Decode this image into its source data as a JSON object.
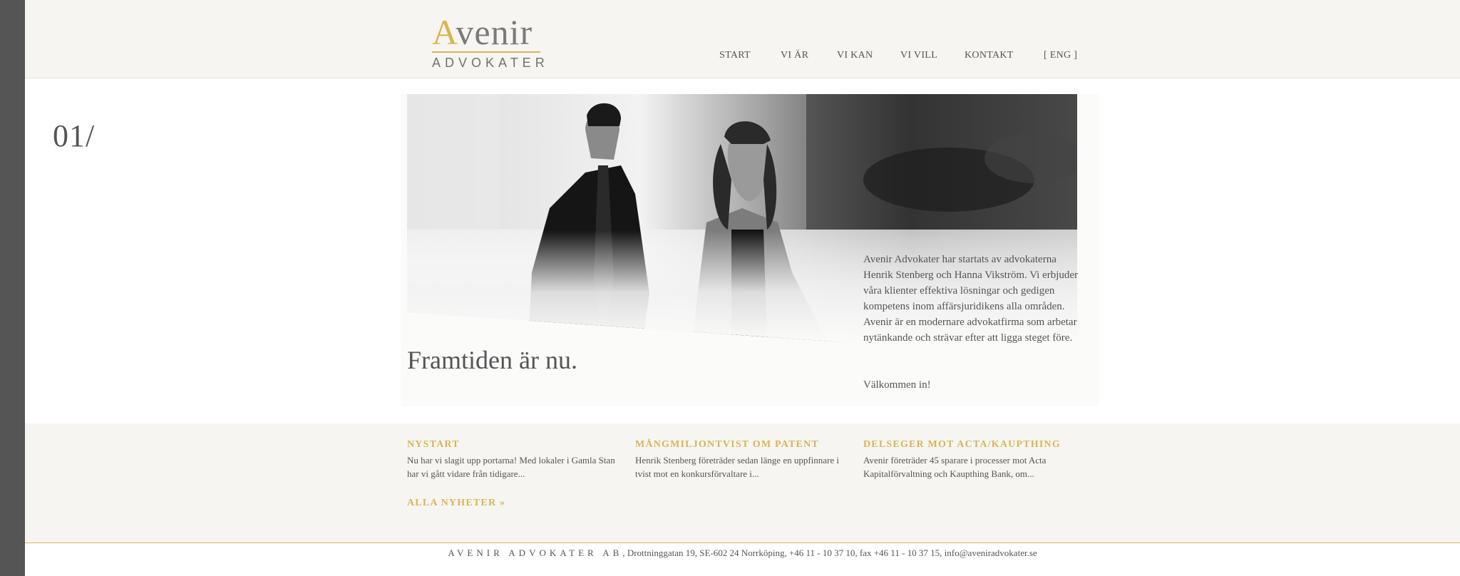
{
  "logo": {
    "initial": "A",
    "rest": "venir",
    "sub": "ADVOKATER"
  },
  "nav": [
    {
      "label": "START"
    },
    {
      "label": "VI ÄR"
    },
    {
      "label": "VI KAN"
    },
    {
      "label": "VI VILL"
    },
    {
      "label": "KONTAKT"
    },
    {
      "label": "[ ENG ]"
    }
  ],
  "page_number": "01/",
  "hero": {
    "title": "Framtiden är nu.",
    "text": "Avenir Advokater har startats av advokaterna Henrik Stenberg och Hanna Vikström. Vi erbjuder våra klienter effektiva lösningar och gedigen kompetens inom affärsjuridikens alla områden. Avenir är en modernare advokatfirma som arbetar nytänkande och strävar efter att ligga steget före.",
    "welcome": "Välkommen in!"
  },
  "news": [
    {
      "title": "NYSTART",
      "text": "Nu har vi slagit upp portarna! Med lokaler i Gamla Stan har vi gått vidare från tidigare..."
    },
    {
      "title": "MÅNGMILJONTVIST OM PATENT",
      "text": "Henrik Stenberg företräder sedan länge en uppfinnare i tvist mot en konkursförvaltare i..."
    },
    {
      "title": "DELSEGER MOT ACTA/KAUPTHING",
      "text": "Avenir företräder 45 sparare i processer mot Acta Kapitalförvaltning och Kaupthing Bank, om..."
    }
  ],
  "all_news": "ALLA NYHETER »",
  "footer": {
    "company": "AVENIR ADVOKATER AB",
    "details": ", Drottninggatan 19, SE-602 24 Norrköping, +46 11 - 10 37 10, fax +46 11 - 10 37 15, info@aveniradvokater.se"
  },
  "colors": {
    "accent": "#d8b552",
    "text": "#555555",
    "band": "#f6f5f2",
    "sidebar": "#555555"
  }
}
